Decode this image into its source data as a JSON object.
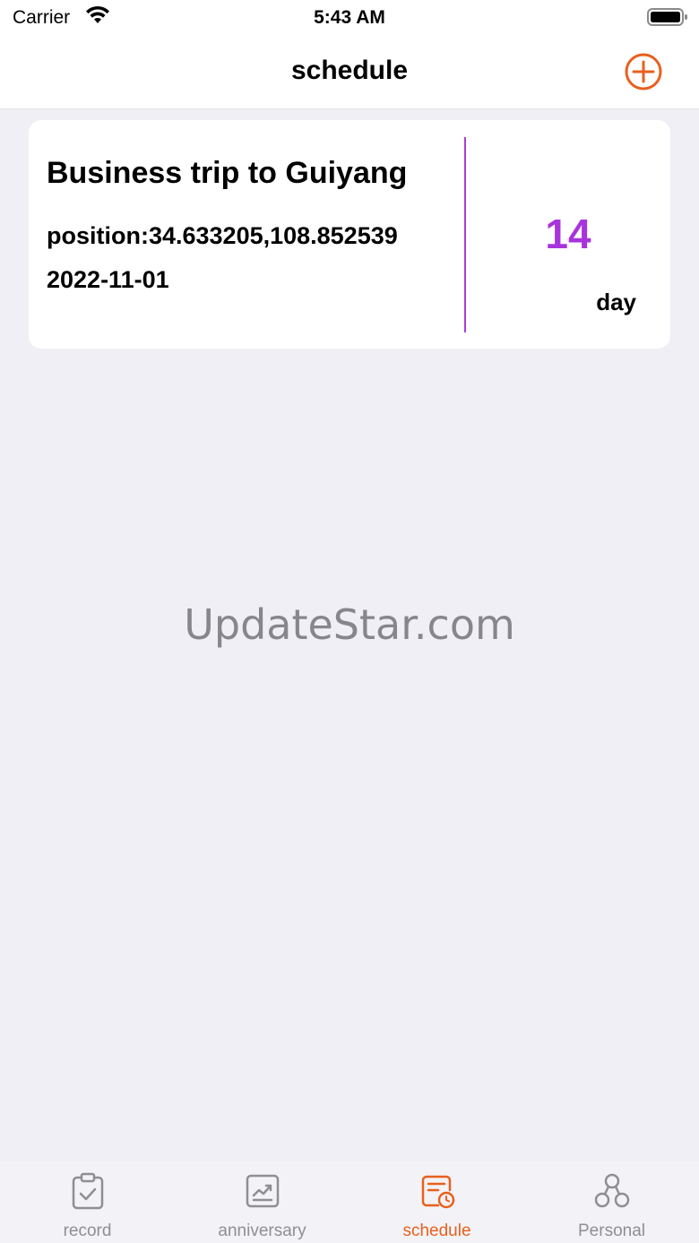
{
  "status_bar": {
    "carrier": "Carrier",
    "time": "5:43 AM"
  },
  "nav": {
    "title": "schedule",
    "add_icon": "plus-circle-icon"
  },
  "schedule_card": {
    "title": "Business trip to Guiyang",
    "position": "position:34.633205,108.852539",
    "date": "2022-11-01",
    "count": "14",
    "unit": "day"
  },
  "watermark": "UpdateStar.com",
  "tabs": [
    {
      "label": "record",
      "icon": "clipboard-check-icon",
      "active": false
    },
    {
      "label": "anniversary",
      "icon": "chart-trend-icon",
      "active": false
    },
    {
      "label": "schedule",
      "icon": "calendar-clock-icon",
      "active": true
    },
    {
      "label": "Personal",
      "icon": "nodes-icon",
      "active": false
    }
  ],
  "colors": {
    "accent": "#e8601d",
    "card_highlight": "#a833dc",
    "background": "#f0eff5",
    "tab_inactive": "#8e8e93"
  }
}
